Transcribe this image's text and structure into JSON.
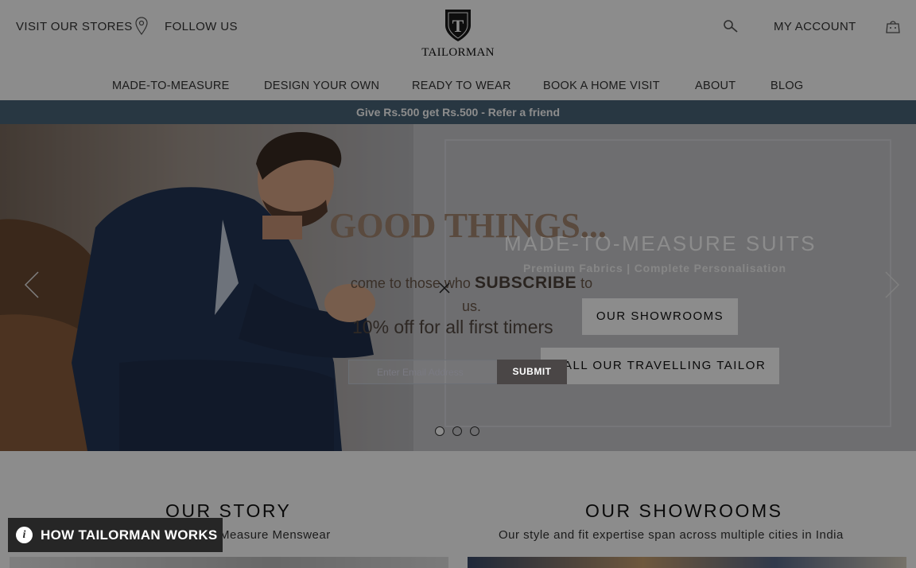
{
  "header": {
    "visit_stores": "VISIT OUR STORES",
    "follow_us": "FOLLOW US",
    "logo_monogram": "T",
    "logo_text": "TAILORMAN",
    "my_account": "MY ACCOUNT",
    "icons": {
      "location": "map-pin-icon",
      "search": "search-icon",
      "cart": "shopping-bag-icon"
    }
  },
  "nav": {
    "items": [
      {
        "label": "MADE-TO-MEASURE"
      },
      {
        "label": "DESIGN YOUR OWN"
      },
      {
        "label": "READY TO WEAR"
      },
      {
        "label": "BOOK A HOME VISIT"
      },
      {
        "label": "ABOUT"
      },
      {
        "label": "BLOG"
      }
    ]
  },
  "promo": {
    "text": "Give Rs.500 get Rs.500 - Refer a friend",
    "background": "#4a6478"
  },
  "hero": {
    "title": "MADE-TO-MEASURE SUITS",
    "subtitle": "Premium Fabrics | Complete Personalisation",
    "buttons": [
      {
        "label": "OUR SHOWROOMS"
      },
      {
        "label": "CALL OUR TRAVELLING TAILOR"
      }
    ],
    "slides": 3,
    "active_slide": 1
  },
  "sections": {
    "story": {
      "title": "OUR STORY",
      "subtitle": "Made-to-Measure Menswear"
    },
    "showrooms": {
      "title": "OUR SHOWROOMS",
      "subtitle": "Our style and fit expertise span across multiple cities in India"
    }
  },
  "popup": {
    "title": "GOOD THINGS...",
    "text_before": "come to those who ",
    "text_strong": "SUBSCRIBE",
    "text_after": " to us.",
    "offer": "10% off for all first timers",
    "email_placeholder": "Enter Email Address",
    "submit_label": "SUBMIT"
  },
  "how_widget": {
    "label": "HOW TAILORMAN WORKS",
    "icon": "info-icon"
  }
}
